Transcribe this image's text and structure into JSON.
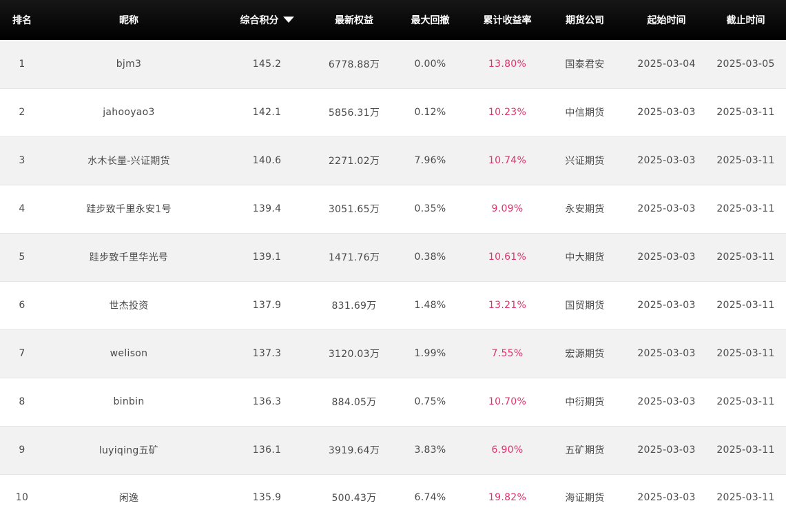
{
  "table": {
    "columns": {
      "rank": "排名",
      "nickname": "昵称",
      "score": "综合积分",
      "equity": "最新权益",
      "drawdown": "最大回撤",
      "return": "累计收益率",
      "broker": "期货公司",
      "start": "起始时间",
      "end": "截止时间"
    },
    "sort": {
      "column": "score",
      "direction": "desc",
      "icon": "caret-down-icon"
    },
    "colors": {
      "header_bg": "#000000",
      "header_text": "#ffffff",
      "return_text": "#e0316f",
      "row_alt": "#f2f2f2"
    },
    "rows": [
      {
        "rank": "1",
        "nickname": "bjm3",
        "score": "145.2",
        "equity": "6778.88万",
        "drawdown": "0.00%",
        "return": "13.80%",
        "broker": "国泰君安",
        "start": "2025-03-04",
        "end": "2025-03-05"
      },
      {
        "rank": "2",
        "nickname": "jahooyao3",
        "score": "142.1",
        "equity": "5856.31万",
        "drawdown": "0.12%",
        "return": "10.23%",
        "broker": "中信期货",
        "start": "2025-03-03",
        "end": "2025-03-11"
      },
      {
        "rank": "3",
        "nickname": "水木长量-兴证期货",
        "score": "140.6",
        "equity": "2271.02万",
        "drawdown": "7.96%",
        "return": "10.74%",
        "broker": "兴证期货",
        "start": "2025-03-03",
        "end": "2025-03-11"
      },
      {
        "rank": "4",
        "nickname": "跬步致千里永安1号",
        "score": "139.4",
        "equity": "3051.65万",
        "drawdown": "0.35%",
        "return": "9.09%",
        "broker": "永安期货",
        "start": "2025-03-03",
        "end": "2025-03-11"
      },
      {
        "rank": "5",
        "nickname": "跬步致千里华光号",
        "score": "139.1",
        "equity": "1471.76万",
        "drawdown": "0.38%",
        "return": "10.61%",
        "broker": "中大期货",
        "start": "2025-03-03",
        "end": "2025-03-11"
      },
      {
        "rank": "6",
        "nickname": "世杰投资",
        "score": "137.9",
        "equity": "831.69万",
        "drawdown": "1.48%",
        "return": "13.21%",
        "broker": "国贸期货",
        "start": "2025-03-03",
        "end": "2025-03-11"
      },
      {
        "rank": "7",
        "nickname": "welison",
        "score": "137.3",
        "equity": "3120.03万",
        "drawdown": "1.99%",
        "return": "7.55%",
        "broker": "宏源期货",
        "start": "2025-03-03",
        "end": "2025-03-11"
      },
      {
        "rank": "8",
        "nickname": "binbin",
        "score": "136.3",
        "equity": "884.05万",
        "drawdown": "0.75%",
        "return": "10.70%",
        "broker": "中衍期货",
        "start": "2025-03-03",
        "end": "2025-03-11"
      },
      {
        "rank": "9",
        "nickname": "luyiqing五矿",
        "score": "136.1",
        "equity": "3919.64万",
        "drawdown": "3.83%",
        "return": "6.90%",
        "broker": "五矿期货",
        "start": "2025-03-03",
        "end": "2025-03-11"
      },
      {
        "rank": "10",
        "nickname": "闲逸",
        "score": "135.9",
        "equity": "500.43万",
        "drawdown": "6.74%",
        "return": "19.82%",
        "broker": "海证期货",
        "start": "2025-03-03",
        "end": "2025-03-11"
      }
    ]
  }
}
